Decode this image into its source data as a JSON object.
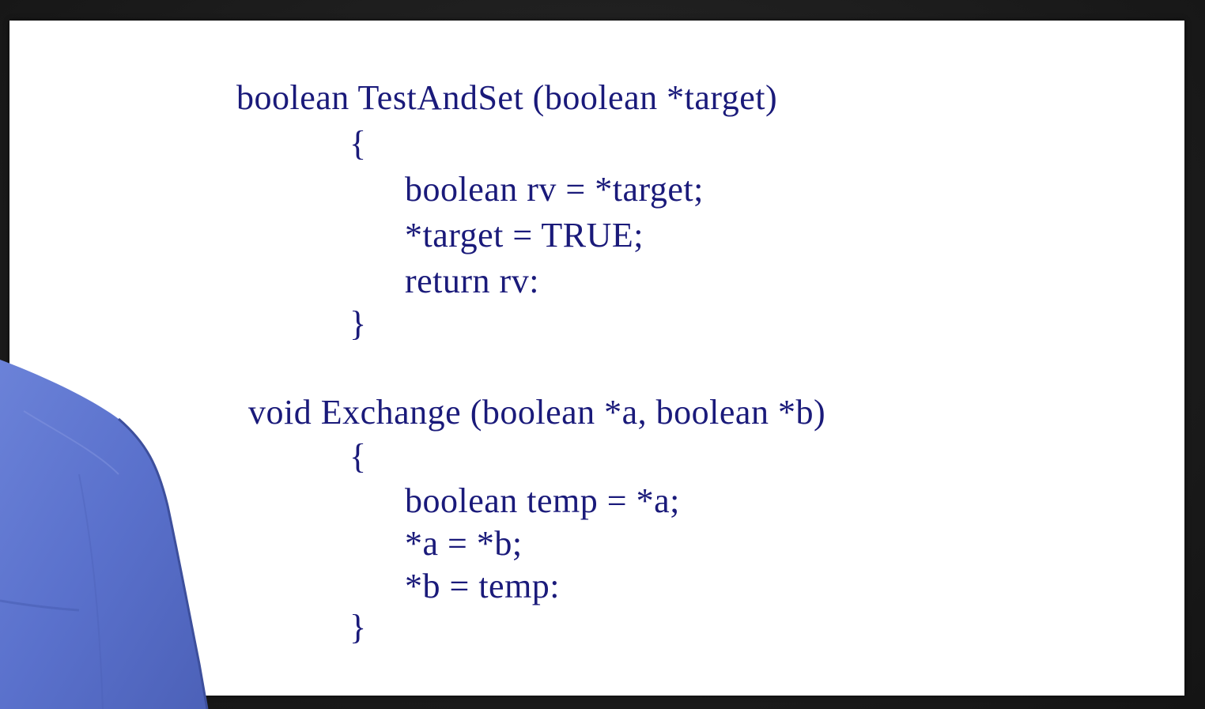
{
  "slide": {
    "function1": {
      "signature": "boolean TestAndSet (boolean *target)",
      "open_brace": "{",
      "body": [
        "boolean rv = *target;",
        "*target = TRUE;",
        "return rv:"
      ],
      "close_brace": "}"
    },
    "function2": {
      "signature": "void Exchange (boolean *a, boolean *b)",
      "open_brace": "{",
      "body": [
        "boolean temp = *a;",
        "*a = *b;",
        "*b = temp:"
      ],
      "close_brace": "}"
    }
  },
  "colors": {
    "code_text": "#1a1a7a",
    "slide_background": "#ffffff",
    "frame_background": "#1c1c1c",
    "shirt": "#5b73cf"
  }
}
